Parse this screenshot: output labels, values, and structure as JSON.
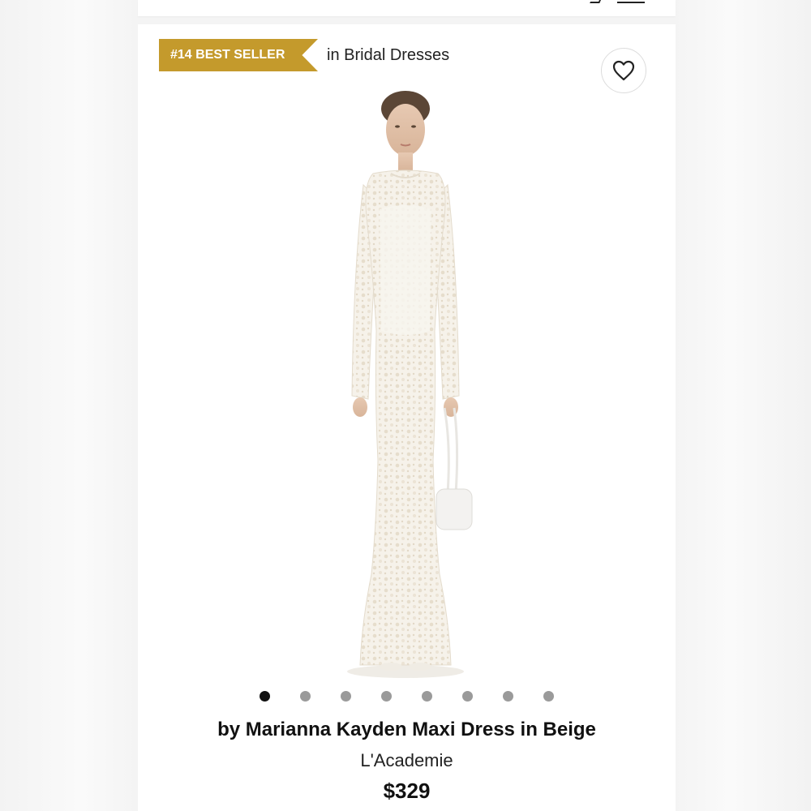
{
  "badge": {
    "rank_label": "#14 BEST SELLER",
    "category": "in Bridal Dresses"
  },
  "colors": {
    "badge": "#c49a2c",
    "dot_active": "#111111",
    "dot_inactive": "#9a9a9a"
  },
  "icons": {
    "favorite": "heart-icon"
  },
  "carousel": {
    "total": 8,
    "active_index": 0
  },
  "product": {
    "title": "by Marianna Kayden Maxi Dress in Beige",
    "brand": "L'Academie",
    "price": "$329"
  }
}
